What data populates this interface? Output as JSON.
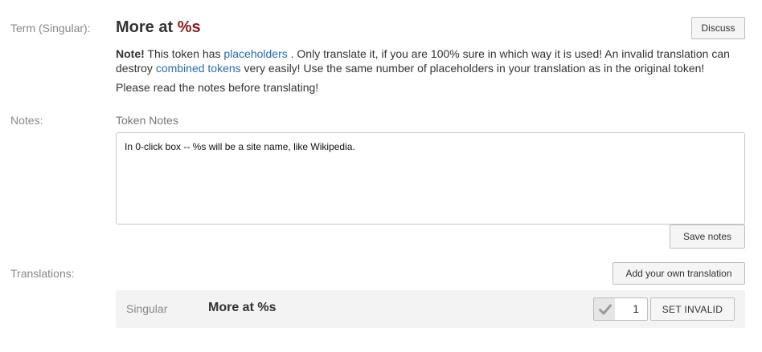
{
  "term": {
    "label": "Term (Singular):",
    "title_prefix": "More at ",
    "title_placeholder": "%s",
    "discuss_label": "Discuss"
  },
  "note": {
    "strong": "Note!",
    "text1": " This token has ",
    "link_placeholders": "placeholders",
    "text2": " . Only translate it, if you are 100% sure in which way it is used! An invalid translation can destroy ",
    "link_combined": "combined tokens",
    "text3": " very easily! Use the same number of placeholders in your translation as in the original token!",
    "read_notes": "Please read the notes before translating!"
  },
  "notes": {
    "label": "Notes:",
    "heading": "Token Notes",
    "value": "In 0-click box -- %s will be a site name, like Wikipedia.",
    "save_label": "Save notes"
  },
  "translations": {
    "label": "Translations:",
    "add_label": "Add your own translation",
    "items": [
      {
        "kind": "Singular",
        "text": "More at %s",
        "count": "1",
        "set_invalid_label": "SET INVALID"
      }
    ]
  }
}
